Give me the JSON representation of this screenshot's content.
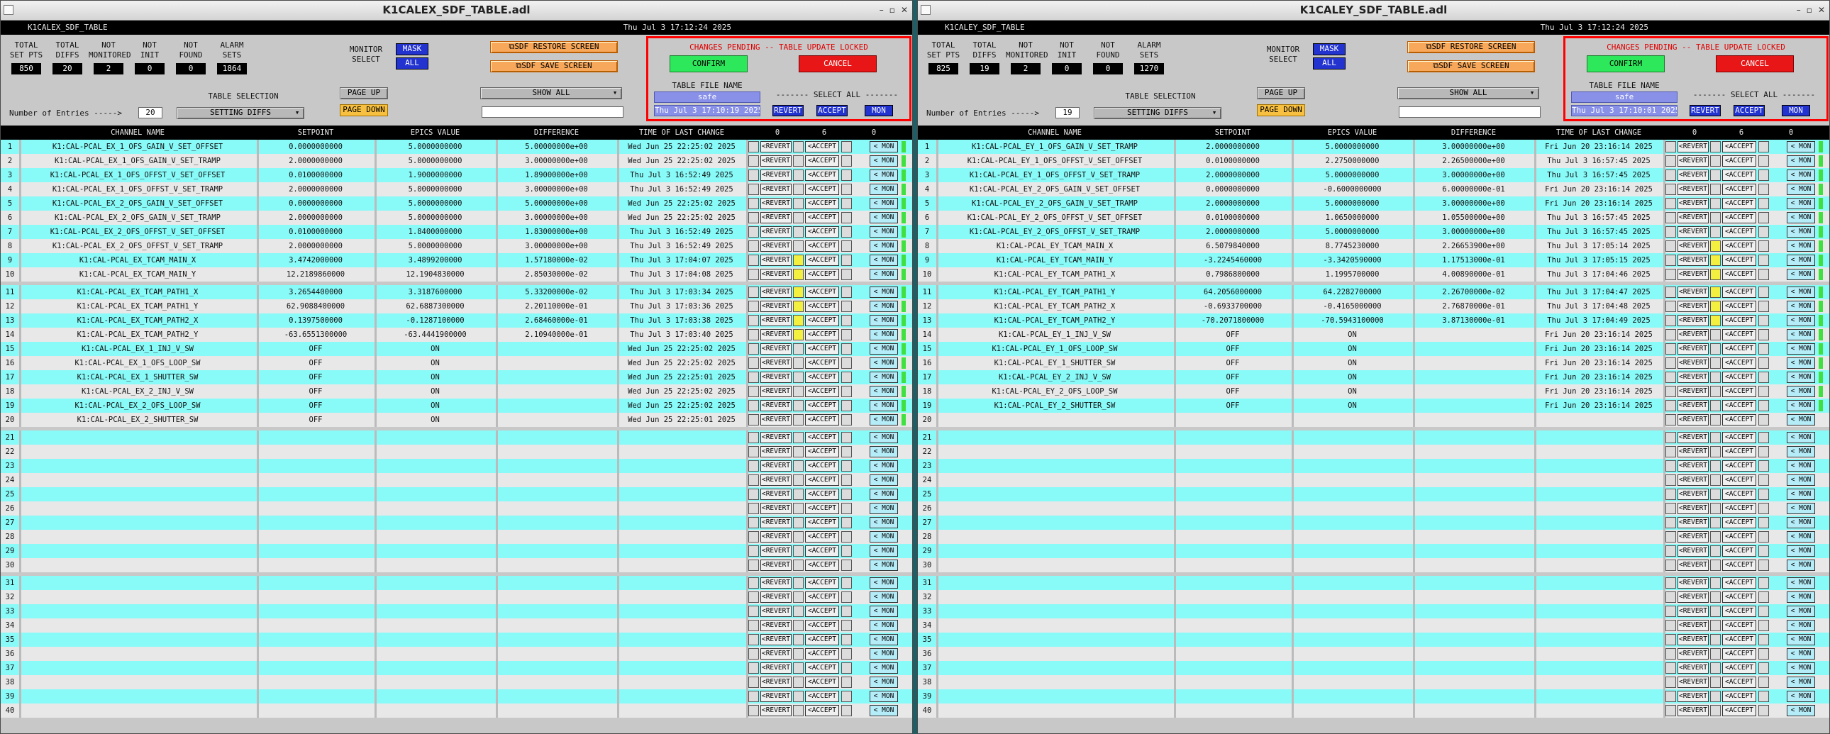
{
  "windows": [
    {
      "id": "left",
      "title": "K1CALEX_SDF_TABLE.adl",
      "header_name": "K1CALEX_SDF_TABLE",
      "header_date": "Thu Jul  3 17:12:24 2025",
      "stats": [
        {
          "label1": "TOTAL",
          "label2": "SET PTS",
          "value": "850"
        },
        {
          "label1": "TOTAL",
          "label2": "DIFFS",
          "value": "20"
        },
        {
          "label1": "NOT",
          "label2": "MONITORED",
          "value": "2"
        },
        {
          "label1": "NOT",
          "label2": "INIT",
          "value": "0"
        },
        {
          "label1": "NOT",
          "label2": "FOUND",
          "value": "0"
        },
        {
          "label1": "ALARM",
          "label2": "SETS",
          "value": "1864"
        }
      ],
      "monitor_select_label": "MONITOR SELECT",
      "mask_label": "MASK",
      "all_label": "ALL",
      "restore_label": "SDF RESTORE SCREEN",
      "save_label": "SDF SAVE SCREEN",
      "pending_label": "CHANGES PENDING -- TABLE UPDATE LOCKED",
      "confirm_label": "CONFIRM",
      "cancel_label": "CANCEL",
      "table_file_label": "TABLE FILE NAME",
      "table_file_value": "safe",
      "table_file_date": "Thu Jul  3 17:10:19 2025",
      "select_all_label": "------- SELECT ALL -------",
      "revert_label": "REVERT",
      "accept_label": "ACCEPT",
      "mon_label": "MON",
      "table_selection_label": "TABLE SELECTION",
      "page_up_label": "PAGE UP",
      "page_down_label": "PAGE DOWN",
      "show_all_label": "SHOW ALL",
      "entries_label": "Number of Entries ----->",
      "entries_value": "20",
      "setting_diffs_label": "SETTING DIFFS",
      "col_headers": {
        "channel": "CHANNEL NAME",
        "setpoint": "SETPOINT",
        "epics": "EPICS VALUE",
        "diff": "DIFFERENCE",
        "time": "TIME OF LAST CHANGE",
        "cnt1": "0",
        "cnt2": "6",
        "cnt3": "0"
      },
      "rows": [
        {
          "n": "1",
          "ch": "K1:CAL-PCAL_EX_1_OFS_GAIN_V_SET_OFFSET",
          "sp": "0.0000000000",
          "ep": "5.0000000000",
          "df": "5.00000000e+00",
          "tm": "Wed Jun 25 22:25:02 2025",
          "y": false
        },
        {
          "n": "2",
          "ch": "K1:CAL-PCAL_EX_1_OFS_GAIN_V_SET_TRAMP",
          "sp": "2.0000000000",
          "ep": "5.0000000000",
          "df": "3.00000000e+00",
          "tm": "Wed Jun 25 22:25:02 2025",
          "y": false
        },
        {
          "n": "3",
          "ch": "K1:CAL-PCAL_EX_1_OFS_OFFST_V_SET_OFFSET",
          "sp": "0.0100000000",
          "ep": "1.9000000000",
          "df": "1.89000000e+00",
          "tm": "Thu Jul  3 16:52:49 2025",
          "y": false
        },
        {
          "n": "4",
          "ch": "K1:CAL-PCAL_EX_1_OFS_OFFST_V_SET_TRAMP",
          "sp": "2.0000000000",
          "ep": "5.0000000000",
          "df": "3.00000000e+00",
          "tm": "Thu Jul  3 16:52:49 2025",
          "y": false
        },
        {
          "n": "5",
          "ch": "K1:CAL-PCAL_EX_2_OFS_GAIN_V_SET_OFFSET",
          "sp": "0.0000000000",
          "ep": "5.0000000000",
          "df": "5.00000000e+00",
          "tm": "Wed Jun 25 22:25:02 2025",
          "y": false
        },
        {
          "n": "6",
          "ch": "K1:CAL-PCAL_EX_2_OFS_GAIN_V_SET_TRAMP",
          "sp": "2.0000000000",
          "ep": "5.0000000000",
          "df": "3.00000000e+00",
          "tm": "Wed Jun 25 22:25:02 2025",
          "y": false
        },
        {
          "n": "7",
          "ch": "K1:CAL-PCAL_EX_2_OFS_OFFST_V_SET_OFFSET",
          "sp": "0.0100000000",
          "ep": "1.8400000000",
          "df": "1.83000000e+00",
          "tm": "Thu Jul  3 16:52:49 2025",
          "y": false
        },
        {
          "n": "8",
          "ch": "K1:CAL-PCAL_EX_2_OFS_OFFST_V_SET_TRAMP",
          "sp": "2.0000000000",
          "ep": "5.0000000000",
          "df": "3.00000000e+00",
          "tm": "Thu Jul  3 16:52:49 2025",
          "y": false
        },
        {
          "n": "9",
          "ch": "K1:CAL-PCAL_EX_TCAM_MAIN_X",
          "sp": "3.4742000000",
          "ep": "3.4899200000",
          "df": "1.57180000e-02",
          "tm": "Thu Jul  3 17:04:07 2025",
          "y": true
        },
        {
          "n": "10",
          "ch": "K1:CAL-PCAL_EX_TCAM_MAIN_Y",
          "sp": "12.2189860000",
          "ep": "12.1904830000",
          "df": "2.85030000e-02",
          "tm": "Thu Jul  3 17:04:08 2025",
          "y": true
        },
        {
          "n": "11",
          "ch": "K1:CAL-PCAL_EX_TCAM_PATH1_X",
          "sp": "3.2654400000",
          "ep": "3.3187600000",
          "df": "5.33200000e-02",
          "tm": "Thu Jul  3 17:03:34 2025",
          "y": true
        },
        {
          "n": "12",
          "ch": "K1:CAL-PCAL_EX_TCAM_PATH1_Y",
          "sp": "62.9088400000",
          "ep": "62.6887300000",
          "df": "2.20110000e-01",
          "tm": "Thu Jul  3 17:03:36 2025",
          "y": true
        },
        {
          "n": "13",
          "ch": "K1:CAL-PCAL_EX_TCAM_PATH2_X",
          "sp": "0.1397500000",
          "ep": "-0.1287100000",
          "df": "2.68460000e-01",
          "tm": "Thu Jul  3 17:03:38 2025",
          "y": true
        },
        {
          "n": "14",
          "ch": "K1:CAL-PCAL_EX_TCAM_PATH2_Y",
          "sp": "-63.6551300000",
          "ep": "-63.4441900000",
          "df": "2.10940000e-01",
          "tm": "Thu Jul  3 17:03:40 2025",
          "y": true
        },
        {
          "n": "15",
          "ch": "K1:CAL-PCAL_EX_1_INJ_V_SW",
          "sp": "OFF",
          "ep": "ON",
          "df": "",
          "tm": "Wed Jun 25 22:25:02 2025",
          "y": false
        },
        {
          "n": "16",
          "ch": "K1:CAL-PCAL_EX_1_OFS_LOOP_SW",
          "sp": "OFF",
          "ep": "ON",
          "df": "",
          "tm": "Wed Jun 25 22:25:02 2025",
          "y": false
        },
        {
          "n": "17",
          "ch": "K1:CAL-PCAL_EX_1_SHUTTER_SW",
          "sp": "OFF",
          "ep": "ON",
          "df": "",
          "tm": "Wed Jun 25 22:25:01 2025",
          "y": false
        },
        {
          "n": "18",
          "ch": "K1:CAL-PCAL_EX_2_INJ_V_SW",
          "sp": "OFF",
          "ep": "ON",
          "df": "",
          "tm": "Wed Jun 25 22:25:02 2025",
          "y": false
        },
        {
          "n": "19",
          "ch": "K1:CAL-PCAL_EX_2_OFS_LOOP_SW",
          "sp": "OFF",
          "ep": "ON",
          "df": "",
          "tm": "Wed Jun 25 22:25:02 2025",
          "y": false
        },
        {
          "n": "20",
          "ch": "K1:CAL-PCAL_EX_2_SHUTTER_SW",
          "sp": "OFF",
          "ep": "ON",
          "df": "",
          "tm": "Wed Jun 25 22:25:01 2025",
          "y": false
        }
      ]
    },
    {
      "id": "right",
      "title": "K1CALEY_SDF_TABLE.adl",
      "header_name": "K1CALEY_SDF_TABLE",
      "header_date": "Thu Jul  3 17:12:24 2025",
      "stats": [
        {
          "label1": "TOTAL",
          "label2": "SET PTS",
          "value": "825"
        },
        {
          "label1": "TOTAL",
          "label2": "DIFFS",
          "value": "19"
        },
        {
          "label1": "NOT",
          "label2": "MONITORED",
          "value": "2"
        },
        {
          "label1": "NOT",
          "label2": "INIT",
          "value": "0"
        },
        {
          "label1": "NOT",
          "label2": "FOUND",
          "value": "0"
        },
        {
          "label1": "ALARM",
          "label2": "SETS",
          "value": "1270"
        }
      ],
      "monitor_select_label": "MONITOR SELECT",
      "mask_label": "MASK",
      "all_label": "ALL",
      "restore_label": "SDF RESTORE SCREEN",
      "save_label": "SDF SAVE SCREEN",
      "pending_label": "CHANGES PENDING -- TABLE UPDATE LOCKED",
      "confirm_label": "CONFIRM",
      "cancel_label": "CANCEL",
      "table_file_label": "TABLE FILE NAME",
      "table_file_value": "safe",
      "table_file_date": "Thu Jul  3 17:10:01 2025",
      "select_all_label": "------- SELECT ALL -------",
      "revert_label": "REVERT",
      "accept_label": "ACCEPT",
      "mon_label": "MON",
      "table_selection_label": "TABLE SELECTION",
      "page_up_label": "PAGE UP",
      "page_down_label": "PAGE DOWN",
      "show_all_label": "SHOW ALL",
      "entries_label": "Number of Entries ----->",
      "entries_value": "19",
      "setting_diffs_label": "SETTING DIFFS",
      "col_headers": {
        "channel": "CHANNEL NAME",
        "setpoint": "SETPOINT",
        "epics": "EPICS VALUE",
        "diff": "DIFFERENCE",
        "time": "TIME OF LAST CHANGE",
        "cnt1": "0",
        "cnt2": "6",
        "cnt3": "0"
      },
      "rows": [
        {
          "n": "1",
          "ch": "K1:CAL-PCAL_EY_1_OFS_GAIN_V_SET_TRAMP",
          "sp": "2.0000000000",
          "ep": "5.0000000000",
          "df": "3.00000000e+00",
          "tm": "Fri Jun 20 23:16:14 2025",
          "y": false
        },
        {
          "n": "2",
          "ch": "K1:CAL-PCAL_EY_1_OFS_OFFST_V_SET_OFFSET",
          "sp": "0.0100000000",
          "ep": "2.2750000000",
          "df": "2.26500000e+00",
          "tm": "Thu Jul  3 16:57:45 2025",
          "y": false
        },
        {
          "n": "3",
          "ch": "K1:CAL-PCAL_EY_1_OFS_OFFST_V_SET_TRAMP",
          "sp": "2.0000000000",
          "ep": "5.0000000000",
          "df": "3.00000000e+00",
          "tm": "Thu Jul  3 16:57:45 2025",
          "y": false
        },
        {
          "n": "4",
          "ch": "K1:CAL-PCAL_EY_2_OFS_GAIN_V_SET_OFFSET",
          "sp": "0.0000000000",
          "ep": "-0.6000000000",
          "df": "6.00000000e-01",
          "tm": "Fri Jun 20 23:16:14 2025",
          "y": false
        },
        {
          "n": "5",
          "ch": "K1:CAL-PCAL_EY_2_OFS_GAIN_V_SET_TRAMP",
          "sp": "2.0000000000",
          "ep": "5.0000000000",
          "df": "3.00000000e+00",
          "tm": "Fri Jun 20 23:16:14 2025",
          "y": false
        },
        {
          "n": "6",
          "ch": "K1:CAL-PCAL_EY_2_OFS_OFFST_V_SET_OFFSET",
          "sp": "0.0100000000",
          "ep": "1.0650000000",
          "df": "1.05500000e+00",
          "tm": "Thu Jul  3 16:57:45 2025",
          "y": false
        },
        {
          "n": "7",
          "ch": "K1:CAL-PCAL_EY_2_OFS_OFFST_V_SET_TRAMP",
          "sp": "2.0000000000",
          "ep": "5.0000000000",
          "df": "3.00000000e+00",
          "tm": "Thu Jul  3 16:57:45 2025",
          "y": false
        },
        {
          "n": "8",
          "ch": "K1:CAL-PCAL_EY_TCAM_MAIN_X",
          "sp": "6.5079840000",
          "ep": "8.7745230000",
          "df": "2.26653900e+00",
          "tm": "Thu Jul  3 17:05:14 2025",
          "y": true
        },
        {
          "n": "9",
          "ch": "K1:CAL-PCAL_EY_TCAM_MAIN_Y",
          "sp": "-3.2245460000",
          "ep": "-3.3420590000",
          "df": "1.17513000e-01",
          "tm": "Thu Jul  3 17:05:15 2025",
          "y": true
        },
        {
          "n": "10",
          "ch": "K1:CAL-PCAL_EY_TCAM_PATH1_X",
          "sp": "0.7986800000",
          "ep": "1.1995700000",
          "df": "4.00890000e-01",
          "tm": "Thu Jul  3 17:04:46 2025",
          "y": true
        },
        {
          "n": "11",
          "ch": "K1:CAL-PCAL_EY_TCAM_PATH1_Y",
          "sp": "64.2056000000",
          "ep": "64.2282700000",
          "df": "2.26700000e-02",
          "tm": "Thu Jul  3 17:04:47 2025",
          "y": true
        },
        {
          "n": "12",
          "ch": "K1:CAL-PCAL_EY_TCAM_PATH2_X",
          "sp": "-0.6933700000",
          "ep": "-0.4165000000",
          "df": "2.76870000e-01",
          "tm": "Thu Jul  3 17:04:48 2025",
          "y": true
        },
        {
          "n": "13",
          "ch": "K1:CAL-PCAL_EY_TCAM_PATH2_Y",
          "sp": "-70.2071800000",
          "ep": "-70.5943100000",
          "df": "3.87130000e-01",
          "tm": "Thu Jul  3 17:04:49 2025",
          "y": true
        },
        {
          "n": "14",
          "ch": "K1:CAL-PCAL_EY_1_INJ_V_SW",
          "sp": "OFF",
          "ep": "ON",
          "df": "",
          "tm": "Fri Jun 20 23:16:14 2025",
          "y": false
        },
        {
          "n": "15",
          "ch": "K1:CAL-PCAL_EY_1_OFS_LOOP_SW",
          "sp": "OFF",
          "ep": "ON",
          "df": "",
          "tm": "Fri Jun 20 23:16:14 2025",
          "y": false
        },
        {
          "n": "16",
          "ch": "K1:CAL-PCAL_EY_1_SHUTTER_SW",
          "sp": "OFF",
          "ep": "ON",
          "df": "",
          "tm": "Fri Jun 20 23:16:14 2025",
          "y": false
        },
        {
          "n": "17",
          "ch": "K1:CAL-PCAL_EY_2_INJ_V_SW",
          "sp": "OFF",
          "ep": "ON",
          "df": "",
          "tm": "Fri Jun 20 23:16:14 2025",
          "y": false
        },
        {
          "n": "18",
          "ch": "K1:CAL-PCAL_EY_2_OFS_LOOP_SW",
          "sp": "OFF",
          "ep": "ON",
          "df": "",
          "tm": "Fri Jun 20 23:16:14 2025",
          "y": false
        },
        {
          "n": "19",
          "ch": "K1:CAL-PCAL_EY_2_SHUTTER_SW",
          "sp": "OFF",
          "ep": "ON",
          "df": "",
          "tm": "Fri Jun 20 23:16:14 2025",
          "y": false
        }
      ]
    }
  ],
  "row_count": 40,
  "colors": {
    "cyan_row": "#88faf8",
    "gray_row": "#e8e8e8",
    "accent_red": "#ff0000",
    "confirm_green": "#2ee85c",
    "cancel_red": "#e81616",
    "mon_blue": "#2233d0"
  }
}
